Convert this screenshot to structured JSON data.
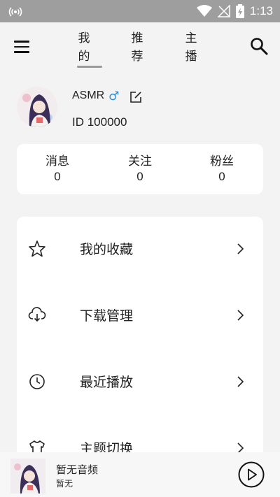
{
  "status": {
    "time": "1:13"
  },
  "tabs": [
    {
      "label": "我的"
    },
    {
      "label": "推荐"
    },
    {
      "label": "主播"
    }
  ],
  "profile": {
    "username": "ASMR",
    "gender_symbol": "♂",
    "id_text": "ID 100000"
  },
  "stats": [
    {
      "label": "消息",
      "value": "0"
    },
    {
      "label": "关注",
      "value": "0"
    },
    {
      "label": "粉丝",
      "value": "0"
    }
  ],
  "menu": [
    {
      "label": "我的收藏",
      "icon": "star-icon"
    },
    {
      "label": "下载管理",
      "icon": "cloud-download-icon"
    },
    {
      "label": "最近播放",
      "icon": "clock-icon"
    },
    {
      "label": "主题切换",
      "icon": "shirt-icon"
    }
  ],
  "player": {
    "title": "暂无音频",
    "subtitle": "暂无"
  },
  "colors": {
    "statusbar": "#9e9e9e",
    "gender": "#2a8fd6",
    "background": "#f3f3f3"
  }
}
